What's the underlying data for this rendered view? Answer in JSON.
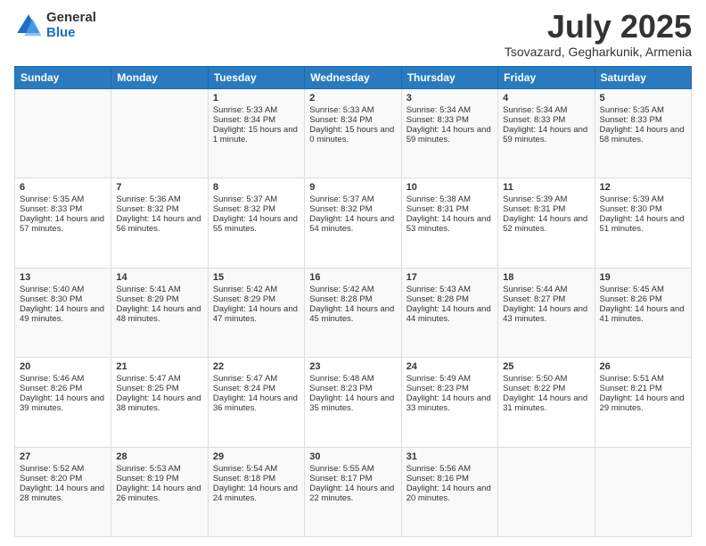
{
  "logo": {
    "general": "General",
    "blue": "Blue"
  },
  "header": {
    "month": "July 2025",
    "location": "Tsovazard, Gegharkunik, Armenia"
  },
  "weekdays": [
    "Sunday",
    "Monday",
    "Tuesday",
    "Wednesday",
    "Thursday",
    "Friday",
    "Saturday"
  ],
  "weeks": [
    [
      {
        "day": "",
        "info": ""
      },
      {
        "day": "",
        "info": ""
      },
      {
        "day": "1",
        "info": "Sunrise: 5:33 AM\nSunset: 8:34 PM\nDaylight: 15 hours and 1 minute."
      },
      {
        "day": "2",
        "info": "Sunrise: 5:33 AM\nSunset: 8:34 PM\nDaylight: 15 hours and 0 minutes."
      },
      {
        "day": "3",
        "info": "Sunrise: 5:34 AM\nSunset: 8:33 PM\nDaylight: 14 hours and 59 minutes."
      },
      {
        "day": "4",
        "info": "Sunrise: 5:34 AM\nSunset: 8:33 PM\nDaylight: 14 hours and 59 minutes."
      },
      {
        "day": "5",
        "info": "Sunrise: 5:35 AM\nSunset: 8:33 PM\nDaylight: 14 hours and 58 minutes."
      }
    ],
    [
      {
        "day": "6",
        "info": "Sunrise: 5:35 AM\nSunset: 8:33 PM\nDaylight: 14 hours and 57 minutes."
      },
      {
        "day": "7",
        "info": "Sunrise: 5:36 AM\nSunset: 8:32 PM\nDaylight: 14 hours and 56 minutes."
      },
      {
        "day": "8",
        "info": "Sunrise: 5:37 AM\nSunset: 8:32 PM\nDaylight: 14 hours and 55 minutes."
      },
      {
        "day": "9",
        "info": "Sunrise: 5:37 AM\nSunset: 8:32 PM\nDaylight: 14 hours and 54 minutes."
      },
      {
        "day": "10",
        "info": "Sunrise: 5:38 AM\nSunset: 8:31 PM\nDaylight: 14 hours and 53 minutes."
      },
      {
        "day": "11",
        "info": "Sunrise: 5:39 AM\nSunset: 8:31 PM\nDaylight: 14 hours and 52 minutes."
      },
      {
        "day": "12",
        "info": "Sunrise: 5:39 AM\nSunset: 8:30 PM\nDaylight: 14 hours and 51 minutes."
      }
    ],
    [
      {
        "day": "13",
        "info": "Sunrise: 5:40 AM\nSunset: 8:30 PM\nDaylight: 14 hours and 49 minutes."
      },
      {
        "day": "14",
        "info": "Sunrise: 5:41 AM\nSunset: 8:29 PM\nDaylight: 14 hours and 48 minutes."
      },
      {
        "day": "15",
        "info": "Sunrise: 5:42 AM\nSunset: 8:29 PM\nDaylight: 14 hours and 47 minutes."
      },
      {
        "day": "16",
        "info": "Sunrise: 5:42 AM\nSunset: 8:28 PM\nDaylight: 14 hours and 45 minutes."
      },
      {
        "day": "17",
        "info": "Sunrise: 5:43 AM\nSunset: 8:28 PM\nDaylight: 14 hours and 44 minutes."
      },
      {
        "day": "18",
        "info": "Sunrise: 5:44 AM\nSunset: 8:27 PM\nDaylight: 14 hours and 43 minutes."
      },
      {
        "day": "19",
        "info": "Sunrise: 5:45 AM\nSunset: 8:26 PM\nDaylight: 14 hours and 41 minutes."
      }
    ],
    [
      {
        "day": "20",
        "info": "Sunrise: 5:46 AM\nSunset: 8:26 PM\nDaylight: 14 hours and 39 minutes."
      },
      {
        "day": "21",
        "info": "Sunrise: 5:47 AM\nSunset: 8:25 PM\nDaylight: 14 hours and 38 minutes."
      },
      {
        "day": "22",
        "info": "Sunrise: 5:47 AM\nSunset: 8:24 PM\nDaylight: 14 hours and 36 minutes."
      },
      {
        "day": "23",
        "info": "Sunrise: 5:48 AM\nSunset: 8:23 PM\nDaylight: 14 hours and 35 minutes."
      },
      {
        "day": "24",
        "info": "Sunrise: 5:49 AM\nSunset: 8:23 PM\nDaylight: 14 hours and 33 minutes."
      },
      {
        "day": "25",
        "info": "Sunrise: 5:50 AM\nSunset: 8:22 PM\nDaylight: 14 hours and 31 minutes."
      },
      {
        "day": "26",
        "info": "Sunrise: 5:51 AM\nSunset: 8:21 PM\nDaylight: 14 hours and 29 minutes."
      }
    ],
    [
      {
        "day": "27",
        "info": "Sunrise: 5:52 AM\nSunset: 8:20 PM\nDaylight: 14 hours and 28 minutes."
      },
      {
        "day": "28",
        "info": "Sunrise: 5:53 AM\nSunset: 8:19 PM\nDaylight: 14 hours and 26 minutes."
      },
      {
        "day": "29",
        "info": "Sunrise: 5:54 AM\nSunset: 8:18 PM\nDaylight: 14 hours and 24 minutes."
      },
      {
        "day": "30",
        "info": "Sunrise: 5:55 AM\nSunset: 8:17 PM\nDaylight: 14 hours and 22 minutes."
      },
      {
        "day": "31",
        "info": "Sunrise: 5:56 AM\nSunset: 8:16 PM\nDaylight: 14 hours and 20 minutes."
      },
      {
        "day": "",
        "info": ""
      },
      {
        "day": "",
        "info": ""
      }
    ]
  ]
}
